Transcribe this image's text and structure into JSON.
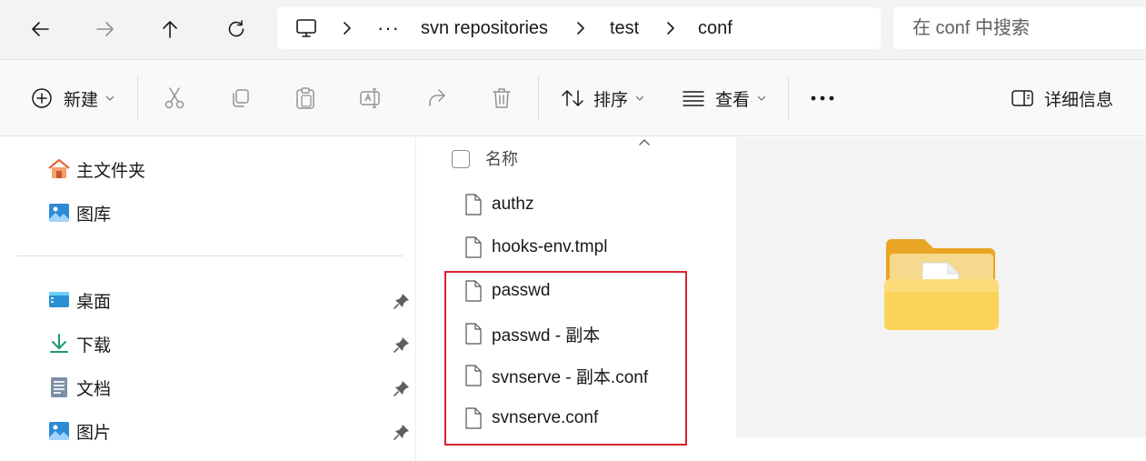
{
  "address_bar": {
    "crumbs": [
      "svn repositories",
      "test",
      "conf"
    ],
    "overflow": "···"
  },
  "search": {
    "placeholder": "在 conf 中搜索"
  },
  "commands": {
    "new_label": "新建",
    "sort_label": "排序",
    "view_label": "查看",
    "details_label": "详细信息"
  },
  "nav": {
    "quick": [
      {
        "label": "主文件夹",
        "icon": "home-icon"
      },
      {
        "label": "图库",
        "icon": "gallery-icon"
      }
    ],
    "pinned": [
      {
        "label": "桌面",
        "icon": "desktop-icon"
      },
      {
        "label": "下载",
        "icon": "download-icon"
      },
      {
        "label": "文档",
        "icon": "document-icon"
      },
      {
        "label": "图片",
        "icon": "pictures-icon"
      }
    ]
  },
  "file_list": {
    "column_name": "名称",
    "files": [
      {
        "name": "authz"
      },
      {
        "name": "hooks-env.tmpl"
      },
      {
        "name": "passwd"
      },
      {
        "name": "passwd - 副本"
      },
      {
        "name": "svnserve - 副本.conf"
      },
      {
        "name": "svnserve.conf"
      }
    ]
  },
  "colors": {
    "highlight_box": "#d9232d",
    "folder_yellow": "#f8c94a"
  }
}
